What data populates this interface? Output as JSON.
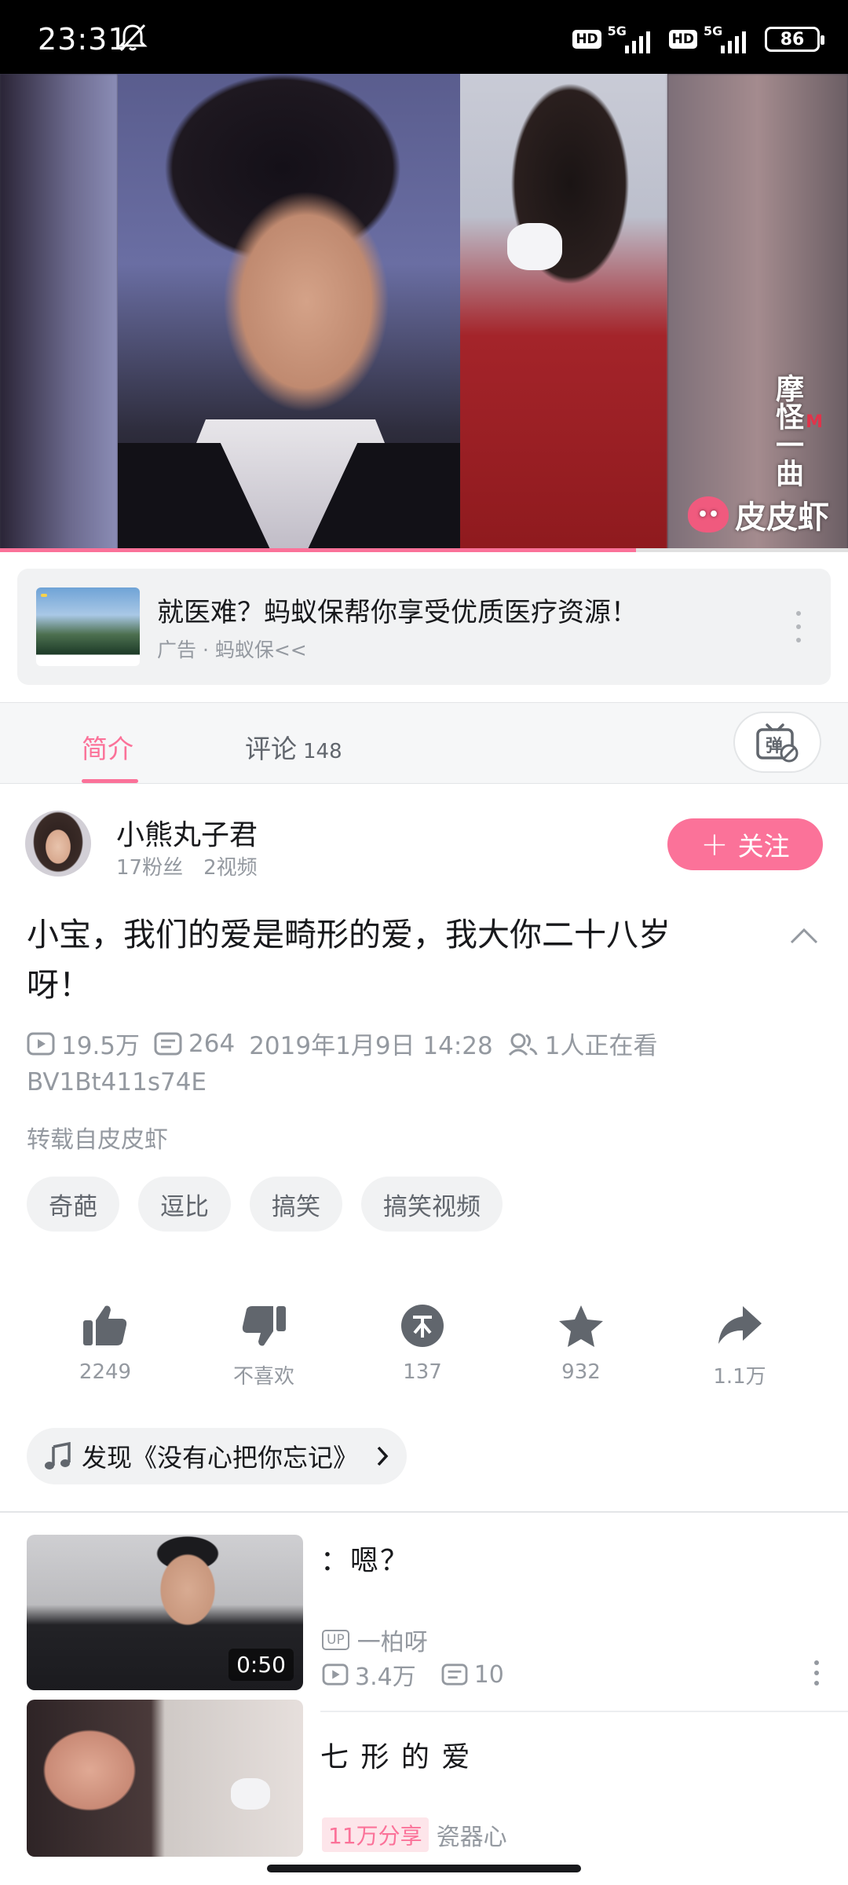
{
  "status_bar": {
    "time": "23:31",
    "hd1": "HD",
    "net1": "5G",
    "hd2": "HD",
    "net2": "5G",
    "battery": "86"
  },
  "video": {
    "watermark_top": "摩怪一曲",
    "watermark_brand": "皮皮虾",
    "watermark_m": "M",
    "progress": 0.75
  },
  "ad": {
    "title": "就医难？蚂蚁保帮你享受优质医疗资源！",
    "subtitle": "广告 · 蚂蚁保<<"
  },
  "tabs": [
    {
      "label": "简介",
      "count": ""
    },
    {
      "label": "评论",
      "count": "148"
    }
  ],
  "danmaku_label": "弹",
  "uploader": {
    "name": "小熊丸子君",
    "fans": "17粉丝",
    "videos": "2视频",
    "follow_label": "关注"
  },
  "video_info": {
    "title": "小宝，我们的爱是畸形的爱，我大你二十八岁呀！",
    "views": "19.5万",
    "danmaku": "264",
    "date": "2019年1月9日 14:28",
    "watching": "1人正在看",
    "bvid": "BV1Bt411s74E",
    "repost": "转载自皮皮虾",
    "tags": [
      "奇葩",
      "逗比",
      "搞笑",
      "搞笑视频"
    ]
  },
  "actions": [
    {
      "icon": "like-icon",
      "label": "2249"
    },
    {
      "icon": "dislike-icon",
      "label": "不喜欢"
    },
    {
      "icon": "coin-icon",
      "label": "137"
    },
    {
      "icon": "star-icon",
      "label": "932"
    },
    {
      "icon": "share-icon",
      "label": "1.1万"
    }
  ],
  "music": {
    "label": "发现《没有心把你忘记》"
  },
  "related": [
    {
      "title": "：嗯？",
      "duration": "0:50",
      "up_badge": "UP",
      "uploader": "一柏呀",
      "views": "3.4万",
      "danmaku": "10"
    },
    {
      "title": "七 形 的 爱",
      "share_badge": "11万分享",
      "uploader": "瓷器心"
    }
  ],
  "colors": {
    "accent": "#fb7299",
    "text": "#18191c",
    "secondary": "#9499a0"
  }
}
